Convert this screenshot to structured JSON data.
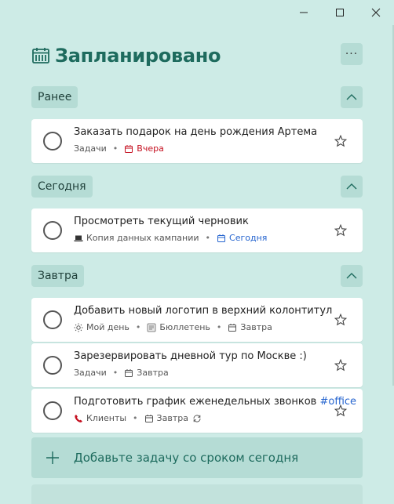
{
  "header": {
    "title": "Запланировано"
  },
  "sections": [
    {
      "label": "Ранее",
      "tasks": [
        {
          "title": "Заказать подарок на день рождения Артема",
          "list": "Задачи",
          "due": "Вчера"
        }
      ]
    },
    {
      "label": "Сегодня",
      "tasks": [
        {
          "title": "Просмотреть текущий черновик",
          "list": "Копия данных кампании",
          "due": "Сегодня"
        }
      ]
    },
    {
      "label": "Завтра",
      "tasks": [
        {
          "title": "Добавить новый логотип в верхний колонтитул",
          "myday": "Мой день",
          "list": "Бюллетень",
          "due": "Завтра"
        },
        {
          "title": "Зарезервировать дневной тур по Москве :)",
          "list": "Задачи",
          "due": "Завтра"
        },
        {
          "title": "Подготовить график еженедельных звонков",
          "tag": "#office",
          "list": "Клиенты",
          "due": "Завтра"
        }
      ]
    }
  ],
  "add_task": {
    "label": "Добавьте задачу со сроком сегодня"
  },
  "colors": {
    "accent": "#1e6b5e",
    "background": "#cdebe6",
    "overdue": "#c50f1f",
    "today": "#2564cf"
  }
}
